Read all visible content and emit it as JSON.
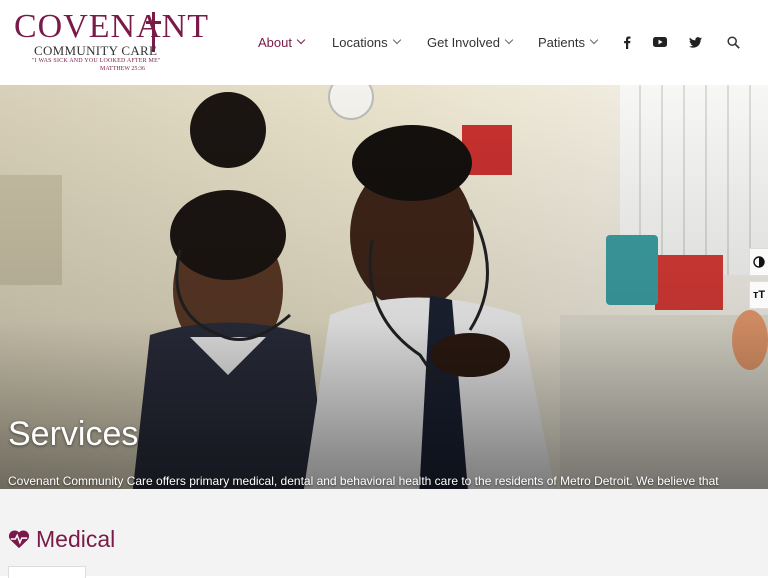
{
  "brand": {
    "name": "Covenant",
    "subtitle": "Community Care",
    "quote": "\"I was sick and you looked after me\"",
    "reference": "Matthew 25:36",
    "color": "#7a1a48"
  },
  "nav": {
    "items": [
      {
        "label": "About",
        "active": true
      },
      {
        "label": "Locations",
        "active": false
      },
      {
        "label": "Get Involved",
        "active": false
      },
      {
        "label": "Patients",
        "active": false
      }
    ],
    "social_icons": [
      "facebook-icon",
      "youtube-icon",
      "twitter-icon"
    ],
    "search_icon": "search-icon"
  },
  "hero": {
    "title": "Services",
    "description": "Covenant Community Care offers primary medical, dental and behavioral health care to the residents of Metro Detroit. We believe that everyone deserves access to integrated, affordable and quality health care, and are dedicated to meeting the primary health care needs of your family."
  },
  "accessibility": {
    "contrast_icon": "contrast-icon",
    "font_size_label": "тT"
  },
  "section": {
    "title": "Medical",
    "icon": "heartbeat-icon"
  }
}
